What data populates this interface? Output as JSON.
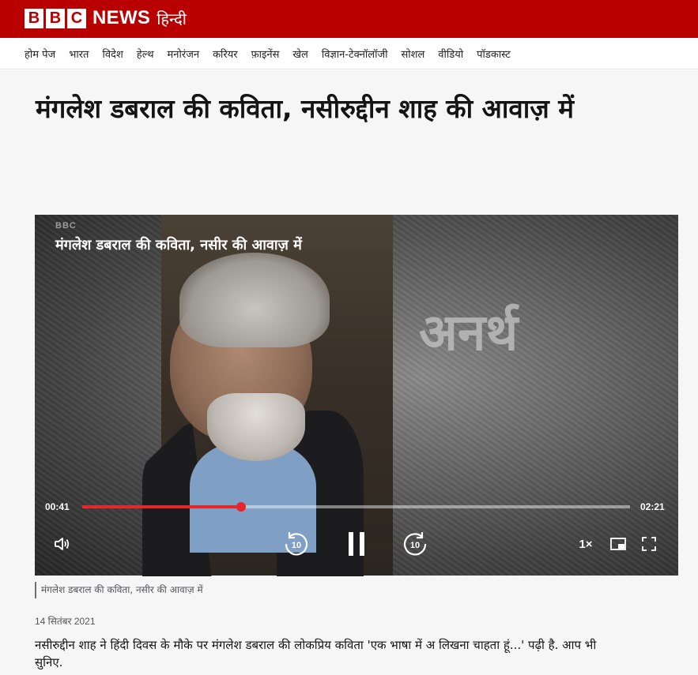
{
  "header": {
    "logo_letters": [
      "B",
      "B",
      "C"
    ],
    "news_label": "NEWS",
    "edition_label": "हिन्दी",
    "brand_color": "#b80000"
  },
  "nav": {
    "items": [
      {
        "label": "होम पेज"
      },
      {
        "label": "भारत"
      },
      {
        "label": "विदेश"
      },
      {
        "label": "हेल्थ"
      },
      {
        "label": "मनोरंजन"
      },
      {
        "label": "करियर"
      },
      {
        "label": "फ़ाइनेंस"
      },
      {
        "label": "खेल"
      },
      {
        "label": "विज्ञान-टेक्नॉलॉजी"
      },
      {
        "label": "सोशल"
      },
      {
        "label": "वीडियो"
      },
      {
        "label": "पॉडकास्ट"
      }
    ]
  },
  "article": {
    "headline": "मंगलेश डबराल की कविता, नसीरुद्दीन शाह की आवाज़ में",
    "caption": "मंगलेश डबराल की कविता, नसीर की आवाज़ में",
    "date": "14 सितंबर 2021",
    "body": "नसीरुद्दीन शाह ने हिंदी दिवस के मौके पर मंगलेश डबराल की लोकप्रिय कविता 'एक भाषा में अ लिखना चाहता हूं...' पढ़ी है. आप भी सुनिए."
  },
  "video": {
    "watermark": "BBC",
    "title": "मंगलेश डबराल की कविता, नसीर की आवाज़ में",
    "overlay_word": "अनर्थ",
    "current_time": "00:41",
    "duration": "02:21",
    "progress_fraction": 0.29,
    "speed_label": "1×",
    "skip_back_label": "10",
    "skip_forward_label": "10",
    "progress_color": "#e5262a",
    "icons": {
      "volume": "volume-icon",
      "rewind": "rewind-10-icon",
      "pause": "pause-icon",
      "forward": "forward-10-icon",
      "pip": "picture-in-picture-icon",
      "fullscreen": "fullscreen-icon"
    }
  }
}
